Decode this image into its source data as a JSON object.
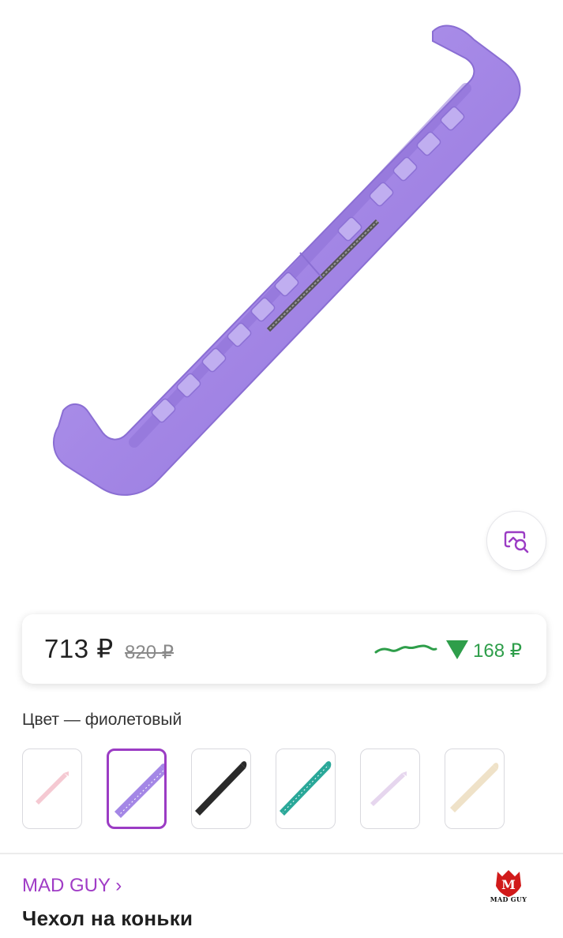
{
  "product": {
    "image_description_icon": "skate-guard-image",
    "brand": "MAD GUY",
    "brand_chevron": "›",
    "title": "Чехол на коньки",
    "brand_logo_text": "MAD GUY"
  },
  "price": {
    "current": "713 ₽",
    "old": "820 ₽",
    "drop": "168 ₽",
    "drop_icon": "triangle-down-icon",
    "trend_icon": "price-history-sparkline"
  },
  "colors": {
    "label": "Цвет — фиолетовый",
    "selected_index": 1,
    "options": [
      {
        "name": "pink",
        "hex": "#f5c9d2"
      },
      {
        "name": "violet",
        "hex": "#a487e6"
      },
      {
        "name": "black",
        "hex": "#2a2a2a"
      },
      {
        "name": "teal",
        "hex": "#2aa899"
      },
      {
        "name": "lilac",
        "hex": "#e6d6ee"
      },
      {
        "name": "beige",
        "hex": "#efe2c8"
      }
    ]
  },
  "theme": {
    "accent": "#9b3cc4",
    "price_drop": "#2e9e4a",
    "guard_main": "#a487e6"
  }
}
